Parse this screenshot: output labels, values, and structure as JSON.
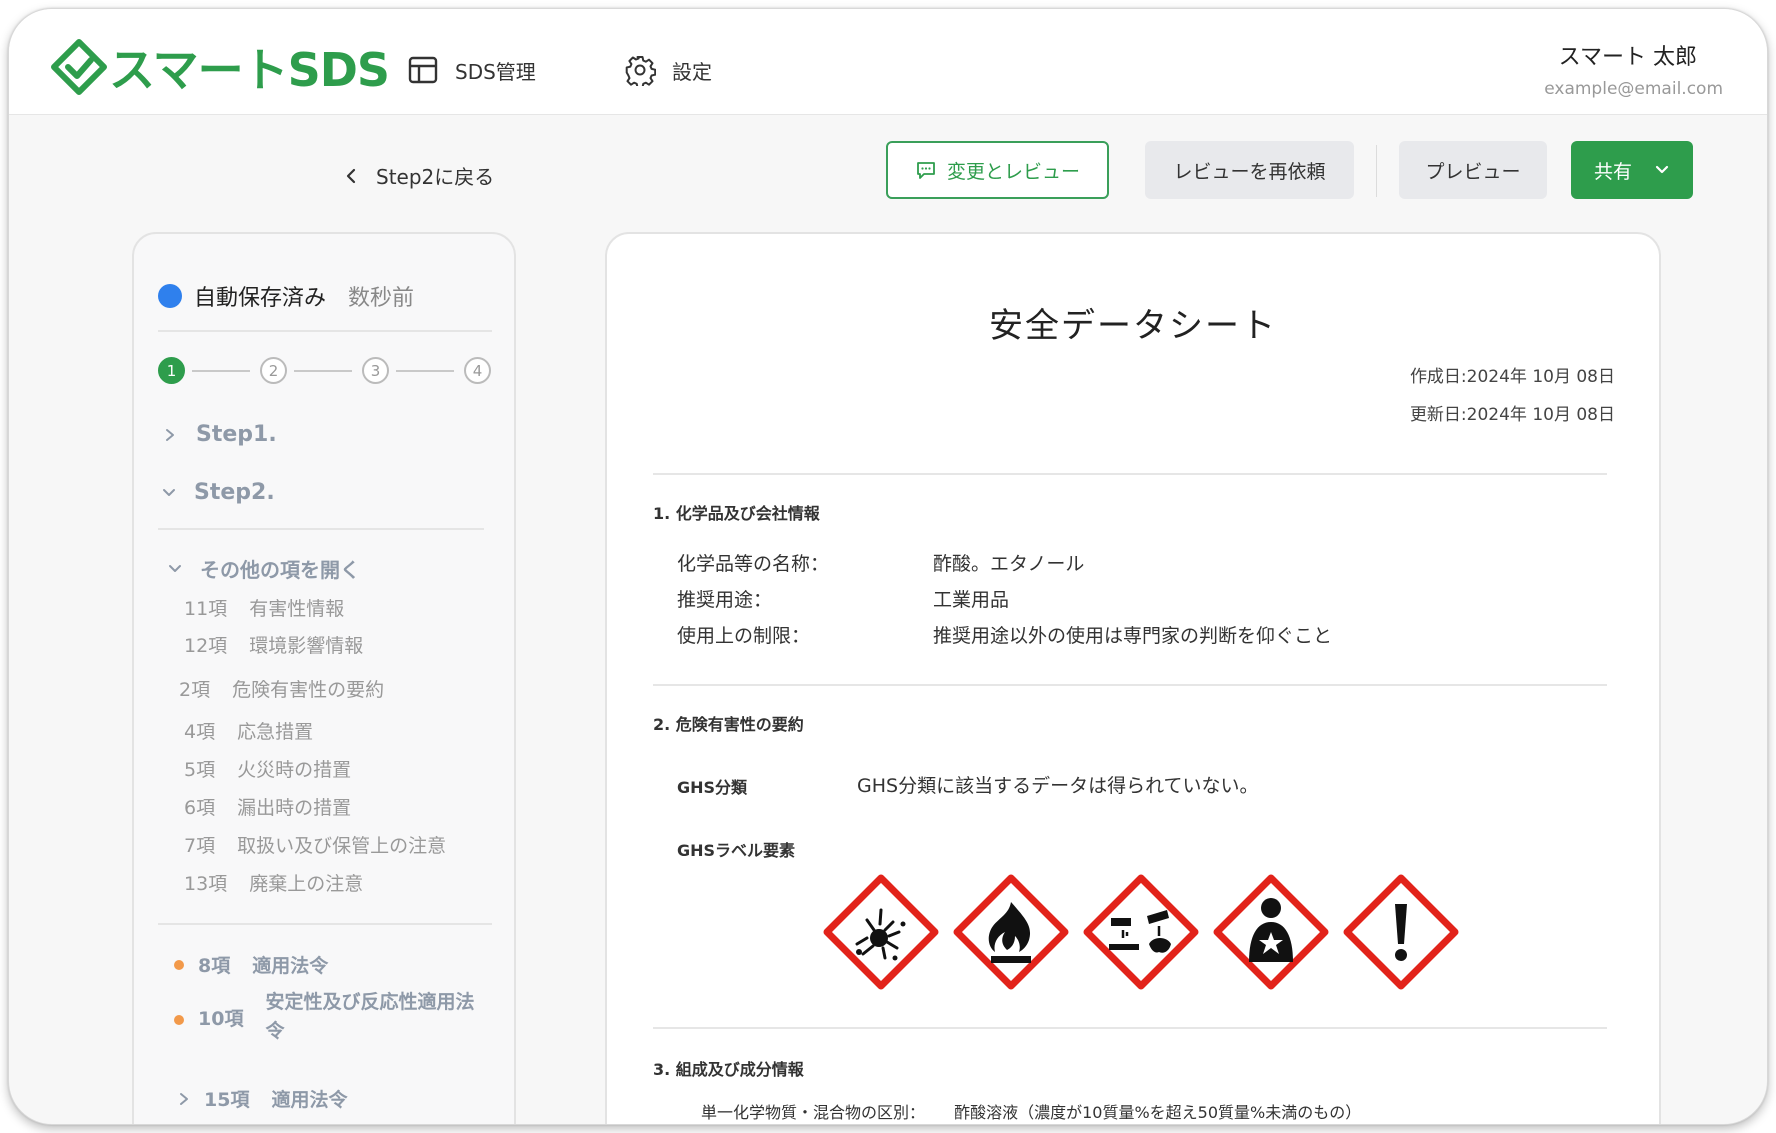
{
  "header": {
    "logo_text": "スマートSDS",
    "nav": [
      {
        "label": "SDS管理",
        "icon": "layout-icon"
      },
      {
        "label": "設定",
        "icon": "gear-icon"
      }
    ],
    "user": {
      "name": "スマート 太郎",
      "email": "example@email.com"
    }
  },
  "actions": {
    "back_label": "Step2に戻る",
    "review_label": "変更とレビュー",
    "rerequest_label": "レビューを再依頼",
    "preview_label": "プレビュー",
    "share_label": "共有"
  },
  "colors": {
    "brand": "#2e9d4c",
    "autosave_dot": "#2f80ed",
    "bullet": "#f2994a",
    "ghs_red": "#e2231a"
  },
  "sidebar": {
    "autosave_label": "自動保存済み",
    "autosave_time": "数秒前",
    "stepper": {
      "steps": [
        "1",
        "2",
        "3",
        "4"
      ],
      "current": 1
    },
    "step1": "Step1.",
    "step2": "Step2.",
    "open_others": "その他の項を開く",
    "sub_items": [
      {
        "num": "11項",
        "label": "有害性情報"
      },
      {
        "num": "12項",
        "label": "環境影響情報"
      },
      {
        "num": "2項",
        "label": "危険有害性の要約"
      },
      {
        "num": "4項",
        "label": "応急措置"
      },
      {
        "num": "5項",
        "label": "火災時の措置"
      },
      {
        "num": "6項",
        "label": "漏出時の措置"
      },
      {
        "num": "7項",
        "label": "取扱い及び保管上の注意"
      },
      {
        "num": "13項",
        "label": "廃棄上の注意"
      }
    ],
    "laws": [
      {
        "num": "8項",
        "label": "適用法令"
      },
      {
        "num": "10項",
        "label": "安定性及び反応性適用法令"
      }
    ],
    "collapsed": {
      "num": "15項",
      "label": "適用法令"
    }
  },
  "document": {
    "title": "安全データシート",
    "created": "作成日:2024年 10月 08日",
    "updated": "更新日:2024年 10月 08日",
    "section1": {
      "title": "1. 化学品及び会社情報",
      "rows": [
        {
          "label": "化学品等の名称：",
          "value": "酢酸。エタノール"
        },
        {
          "label": "推奨用途：",
          "value": "工業用品"
        },
        {
          "label": "使用上の制限：",
          "value": "推奨用途以外の使用は専門家の判断を仰ぐこと"
        }
      ]
    },
    "section2": {
      "title": "2. 危険有害性の要約",
      "ghs_class_label": "GHS分類",
      "ghs_class_value": "GHS分類に該当するデータは得られていない。",
      "ghs_label_elements": "GHSラベル要素",
      "pictograms": [
        "explosive-icon",
        "flammable-icon",
        "corrosive-icon",
        "health-hazard-icon",
        "exclamation-icon"
      ]
    },
    "section3": {
      "title": "3. 組成及び成分情報",
      "row_label": "単一化学物質・混合物の区別：",
      "row_value": "酢酸溶液（濃度が10質量%を超え50質量%未満のもの）"
    }
  }
}
